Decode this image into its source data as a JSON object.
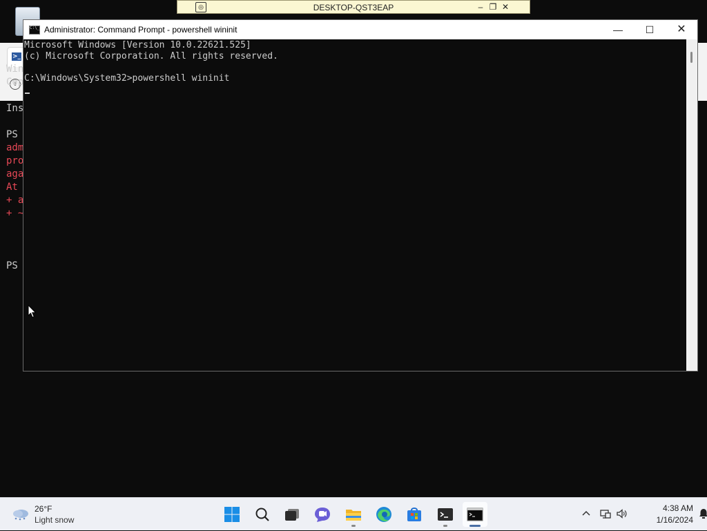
{
  "remote_bar": {
    "title": "DESKTOP-QST3EAP",
    "minimize_glyph": "–",
    "restore_glyph": "❐",
    "close_glyph": "✕"
  },
  "background_powershell": {
    "lines": [
      {
        "text": "Win",
        "error": false
      },
      {
        "text": "Cop",
        "error": false
      },
      {
        "text": "",
        "error": false
      },
      {
        "text": "Ins",
        "error": false
      },
      {
        "text": "",
        "error": false
      },
      {
        "text": "PS",
        "error": false
      },
      {
        "text": "adm",
        "error": true
      },
      {
        "text": "pro",
        "error": true
      },
      {
        "text": "aga",
        "error": true
      },
      {
        "text": "At",
        "error": true
      },
      {
        "text": "+ a",
        "error": true
      },
      {
        "text": "+ ~",
        "error": true
      },
      {
        "text": "",
        "error": false
      },
      {
        "text": "",
        "error": false
      },
      {
        "text": "",
        "error": false
      },
      {
        "text": "PS",
        "error": false
      }
    ]
  },
  "cmd_window": {
    "title": "Administrator: Command Prompt - powershell  wininit",
    "minimize_glyph": "—",
    "maximize_glyph": "☐",
    "close_glyph": "✕",
    "console_lines": [
      "Microsoft Windows [Version 10.0.22621.525]",
      "(c) Microsoft Corporation. All rights reserved.",
      "",
      "C:\\Windows\\System32>powershell wininit"
    ]
  },
  "taskbar": {
    "weather": {
      "temperature": "26°F",
      "condition": "Light snow"
    },
    "apps": [
      {
        "name": "start",
        "icon": "windows-logo-icon",
        "running": false,
        "active": false
      },
      {
        "name": "search",
        "icon": "search-icon",
        "running": false,
        "active": false
      },
      {
        "name": "task-view",
        "icon": "task-view-icon",
        "running": false,
        "active": false
      },
      {
        "name": "chat",
        "icon": "chat-icon",
        "running": false,
        "active": false
      },
      {
        "name": "file-explorer",
        "icon": "folder-icon",
        "running": true,
        "active": false
      },
      {
        "name": "edge",
        "icon": "edge-icon",
        "running": false,
        "active": false
      },
      {
        "name": "store",
        "icon": "store-icon",
        "running": false,
        "active": false
      },
      {
        "name": "terminal",
        "icon": "terminal-icon",
        "running": true,
        "active": false
      },
      {
        "name": "command-prompt",
        "icon": "cmd-icon",
        "running": true,
        "active": true
      }
    ],
    "tray": {
      "time": "4:38 AM",
      "date": "1/16/2024"
    }
  },
  "colors": {
    "console_bg": "#0c0c0c",
    "console_text": "#cccccc",
    "error_text": "#e74856",
    "taskbar_bg": "#eef0f5",
    "remote_bar_bg": "#fbf7d2"
  }
}
